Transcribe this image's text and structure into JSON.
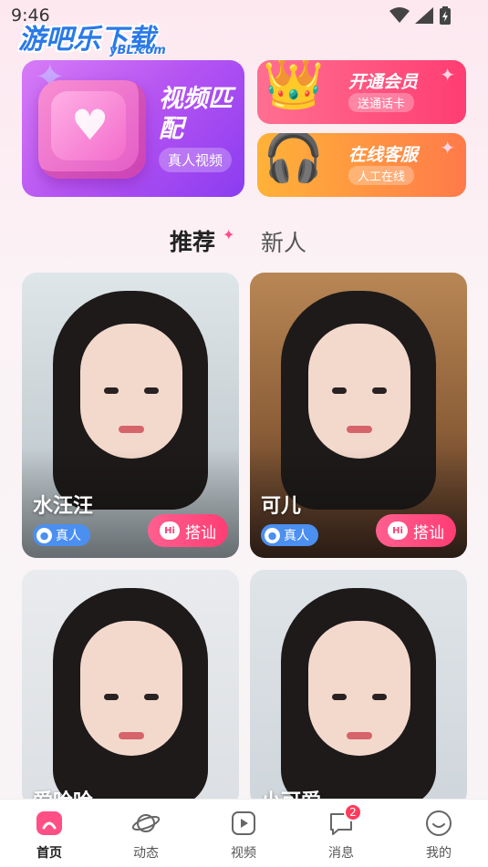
{
  "status_bar": {
    "time": "9:46"
  },
  "watermark": {
    "text": "游吧乐下载",
    "sub": "yBL.com"
  },
  "banners": {
    "video_match": {
      "title": "视频匹配",
      "subtitle": "真人视频"
    },
    "vip": {
      "title": "开通会员",
      "subtitle": "送通话卡"
    },
    "service": {
      "title": "在线客服",
      "subtitle": "人工在线"
    }
  },
  "tabs": [
    {
      "label": "推荐"
    },
    {
      "label": "新人"
    }
  ],
  "cards": [
    {
      "name": "水汪汪",
      "badge": "真人",
      "action": "搭讪"
    },
    {
      "name": "可儿",
      "badge": "真人",
      "action": "搭讪"
    },
    {
      "name": "爱哈哈"
    },
    {
      "name": "小可爱"
    }
  ],
  "bottom_nav": {
    "items": [
      {
        "label": "首页",
        "icon": "home-icon"
      },
      {
        "label": "动态",
        "icon": "planet-icon"
      },
      {
        "label": "视频",
        "icon": "video-play-icon"
      },
      {
        "label": "消息",
        "icon": "message-icon",
        "badge": "2"
      },
      {
        "label": "我的",
        "icon": "smile-face-icon"
      }
    ]
  },
  "colors": {
    "accent": "#ff3d74",
    "verify": "#4b8ff0",
    "badge": "#ff3b5c"
  }
}
